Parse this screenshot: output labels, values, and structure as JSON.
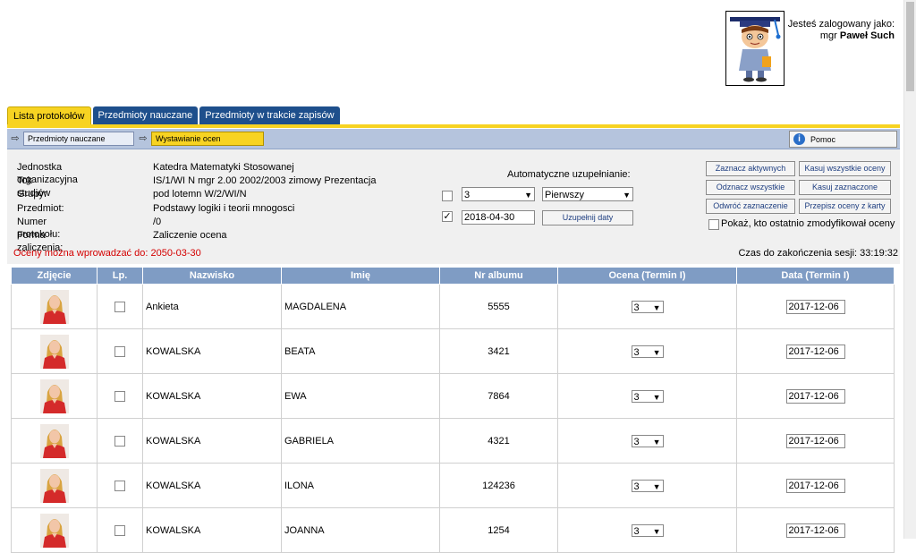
{
  "login": {
    "line1": "Jesteś zalogowany jako:",
    "prefix": "mgr",
    "name": "Paweł Such"
  },
  "tabs": [
    {
      "label": "Lista protokołów",
      "active": true
    },
    {
      "label": "Przedmioty nauczane",
      "active": false
    },
    {
      "label": "Przedmioty w trakcie zapisów",
      "active": false
    }
  ],
  "breadcrumb": {
    "item1": "Przedmioty nauczane",
    "item2": "Wystawianie ocen",
    "help": "Pomoc"
  },
  "info": [
    {
      "label": "Jednostka organizacyjna",
      "value": "Katedra Matematyki Stosowanej"
    },
    {
      "label": "Tok studiów",
      "value": "IS/1/WI N mgr 2.00 2002/2003 zimowy Prezentacja"
    },
    {
      "label": "Grupy:",
      "value": "pod lotemn W/2/WI/N"
    },
    {
      "label": "Przedmiot:",
      "value": "Podstawy logiki i teorii mnogosci"
    },
    {
      "label": "Numer protokołu:",
      "value": "/0"
    },
    {
      "label": "Forma zaliczenia:",
      "value": "Zaliczenie ocena"
    }
  ],
  "deadline": "Oceny można wprowadzać do: 2050-03-30",
  "timer": "Czas do zakończenia sesji: 33:19:32",
  "auto": {
    "title": "Automatyczne uzupełnianie:",
    "grade_value": "3",
    "term_value": "Pierwszy",
    "date_value": "2018-04-30",
    "fill_dates": "Uzupełnij daty"
  },
  "actions": {
    "mark_active": "Zaznacz aktywnych",
    "delete_all": "Kasuj wszystkie oceny",
    "unmark_all": "Odznacz wszystkie",
    "delete_marked": "Kasuj zaznaczone",
    "invert": "Odwróć zaznaczenie",
    "copy_grades": "Przepisz oceny z karty",
    "show_modified": "Pokaż, kto ostatnio zmodyfikował oceny"
  },
  "table": {
    "headers": [
      "Zdjęcie",
      "Lp.",
      "Nazwisko",
      "Imię",
      "Nr albumu",
      "Ocena (Termin I)",
      "Data (Termin I)"
    ],
    "rows": [
      {
        "surname": "Ankieta",
        "name": "MAGDALENA",
        "album": "5555",
        "grade": "3",
        "date": "2017-12-06"
      },
      {
        "surname": "KOWALSKA",
        "name": "BEATA",
        "album": "3421",
        "grade": "3",
        "date": "2017-12-06"
      },
      {
        "surname": "KOWALSKA",
        "name": "EWA",
        "album": "7864",
        "grade": "3",
        "date": "2017-12-06"
      },
      {
        "surname": "KOWALSKA",
        "name": "GABRIELA",
        "album": "4321",
        "grade": "3",
        "date": "2017-12-06"
      },
      {
        "surname": "KOWALSKA",
        "name": "ILONA",
        "album": "124236",
        "grade": "3",
        "date": "2017-12-06"
      },
      {
        "surname": "KOWALSKA",
        "name": "JOANNA",
        "album": "1254",
        "grade": "3",
        "date": "2017-12-06"
      }
    ]
  }
}
